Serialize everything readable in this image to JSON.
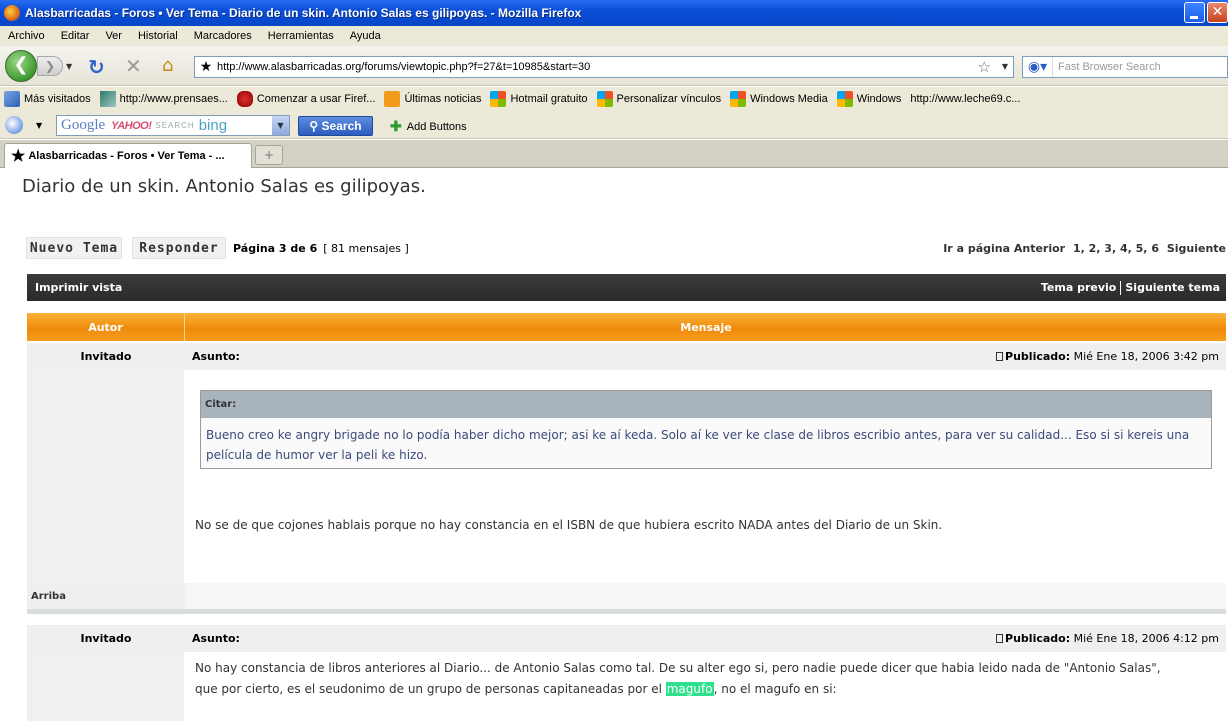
{
  "window": {
    "title": "Alasbarricadas - Foros • Ver Tema - Diario de un skin. Antonio Salas es gilipoyas. - Mozilla Firefox",
    "close_glyph": "✕"
  },
  "menu": [
    "Archivo",
    "Editar",
    "Ver",
    "Historial",
    "Marcadores",
    "Herramientas",
    "Ayuda"
  ],
  "nav": {
    "url": "http://www.alasbarricadas.org/forums/viewtopic.php?f=27&t=10985&start=30",
    "search_placeholder": "Fast Browser Search"
  },
  "bookmarks": [
    {
      "label": "Más visitados",
      "icon": "blue"
    },
    {
      "label": "http://www.prensaes...",
      "icon": "teal"
    },
    {
      "label": "Comenzar a usar Firef...",
      "icon": "red"
    },
    {
      "label": "Últimas noticias",
      "icon": "rss"
    },
    {
      "label": "Hotmail gratuito",
      "icon": "win"
    },
    {
      "label": "Personalizar vínculos",
      "icon": "win"
    },
    {
      "label": "Windows Media",
      "icon": "win"
    },
    {
      "label": "Windows",
      "icon": "win"
    },
    {
      "label": "http://www.leche69.c...",
      "icon": "page"
    }
  ],
  "search_toolbar": {
    "google": "Google",
    "yahoo": "YAHOO!",
    "search_word": "SEARCH",
    "bing": "bing",
    "search_button": "Search",
    "add_buttons": "Add Buttons"
  },
  "tab": {
    "label": "Alasbarricadas - Foros • Ver Tema - ...",
    "new_tab": "+"
  },
  "page": {
    "topic_title": "Diario de un skin. Antonio Salas es gilipoyas.",
    "new_topic": "Nuevo Tema",
    "reply": "Responder",
    "page_label": "Página 3 de 6",
    "count_label": "[ 81 mensajes ]",
    "goto_label": "Ir a página",
    "prev_label": "Anterior",
    "pages": [
      "1",
      "2",
      "3",
      "4",
      "5",
      "6"
    ],
    "next_label": "Siguiente",
    "print_view": "Imprimir vista",
    "prev_topic": "Tema previo",
    "next_topic": "Siguiente tema",
    "col_author": "Autor",
    "col_message": "Mensaje"
  },
  "posts": [
    {
      "author": "Invitado",
      "subject_label": "Asunto:",
      "published_label": "Publicado:",
      "date": "Mié Ene 18, 2006 3:42 pm",
      "quote_label": "Citar:",
      "quote_text": "Bueno creo ke angry brigade no lo podía haber dicho mejor; asi ke aí keda. Solo aí ke ver ke clase de libros escribio antes, para ver su calidad... Eso si si kereis una película de humor ver la peli ke hizo.",
      "body": "No se de que cojones hablais porque no hay constancia en el ISBN de que hubiera escrito NADA antes del Diario de un Skin.",
      "top_link": "Arriba"
    },
    {
      "author": "Invitado",
      "subject_label": "Asunto:",
      "published_label": "Publicado:",
      "date": "Mié Ene 18, 2006 4:12 pm",
      "body_line1": "No hay constancia de libros anteriores al Diario... de Antonio Salas como tal. De su alter ego si, pero nadie puede dicer que habia leido nada de \"Antonio Salas\",",
      "body_line2_a": "que por cierto, es el seudonimo de un grupo de personas capitaneadas por el ",
      "body_line2_hl": "magufo",
      "body_line2_b": ", no el magufo en si:"
    }
  ]
}
